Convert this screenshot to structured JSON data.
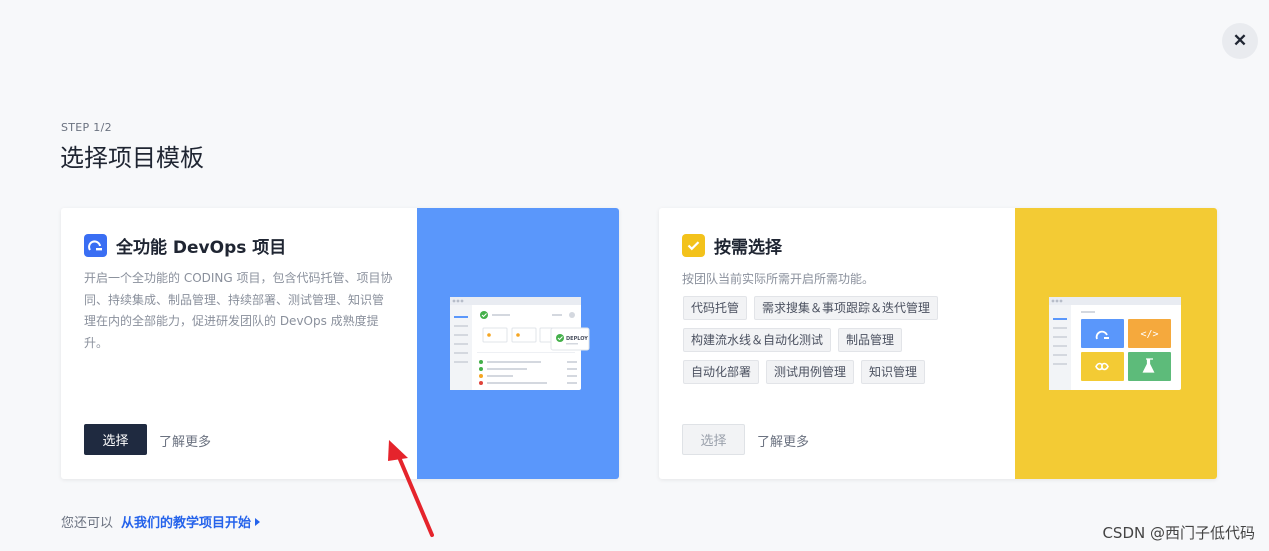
{
  "close": {
    "symbol": "✕"
  },
  "step": "STEP 1/2",
  "title": "选择项目模板",
  "cards": [
    {
      "title": "全功能 DevOps 项目",
      "description": "开启一个全功能的 CODING 项目，包含代码托管、项目协同、持续集成、制品管理、持续部署、测试管理、知识管理在内的全部能力，促进研发团队的 DevOps 成熟度提升。",
      "select_label": "选择",
      "learn_more": "了解更多",
      "art_label": "DEPLOY",
      "colors": {
        "art": "#5a97fb",
        "icon": "#3a6ef3"
      }
    },
    {
      "title": "按需选择",
      "description": "按团队当前实际所需开启所需功能。",
      "tags": [
        "代码托管",
        "需求搜集＆事项跟踪＆迭代管理",
        "构建流水线＆自动化测试",
        "制品管理",
        "自动化部署",
        "测试用例管理",
        "知识管理"
      ],
      "select_label": "选择",
      "learn_more": "了解更多",
      "colors": {
        "art": "#f3cb34",
        "icon": "#f3c21b"
      }
    }
  ],
  "hint": {
    "prefix": "您还可以",
    "link": "从我们的教学项目开始"
  },
  "watermark": "CSDN @西门子低代码"
}
